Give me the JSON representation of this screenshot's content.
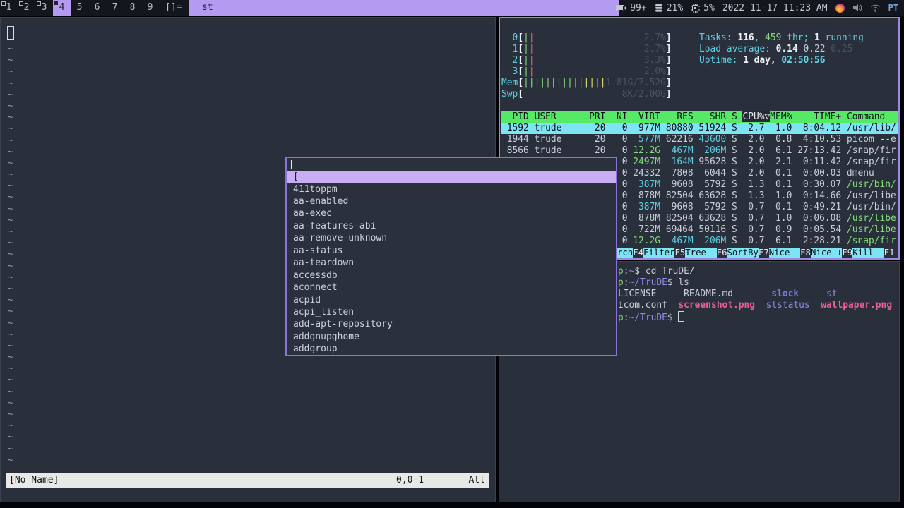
{
  "colors": {
    "accent_lavender": "#b49af0",
    "focused_border_purple": "#9c88e0",
    "dmenu_border": "#8a74da",
    "dmenu_selected_bg": "#c9aef5",
    "htop_header_green": "#56e965",
    "htop_selected_cyan": "#7ce4f2",
    "keyboard_layout_blue": "#6fa8dc"
  },
  "bar": {
    "tags": [
      {
        "label": "1",
        "state": "occupied"
      },
      {
        "label": "2",
        "state": "occupied"
      },
      {
        "label": "3",
        "state": "occupied"
      },
      {
        "label": "4",
        "state": "selected"
      },
      {
        "label": "5",
        "state": "empty"
      },
      {
        "label": "6",
        "state": "empty"
      },
      {
        "label": "7",
        "state": "empty"
      },
      {
        "label": "8",
        "state": "empty"
      },
      {
        "label": "9",
        "state": "empty"
      }
    ],
    "layout_symbol": "[]=",
    "title": "st",
    "status": {
      "battery": "99+",
      "disk": "21%",
      "mem": "5%",
      "datetime": "2022-11-17 11:23 AM",
      "keyboard": "PT",
      "icons": [
        "battery-icon",
        "disk-icon",
        "chip-icon",
        "flame-tray-icon",
        "volume-icon",
        "wifi-icon"
      ]
    }
  },
  "vim": {
    "tildes": [
      "~",
      "~",
      "~",
      "~",
      "~",
      "~",
      "~",
      "~",
      "~",
      "~",
      "~",
      "~",
      "~",
      "~",
      "~",
      "~",
      "~",
      "~",
      "~",
      "~",
      "~",
      "~",
      "~",
      "~",
      "~",
      "~",
      "~",
      "~",
      "~",
      "~",
      "~",
      "~",
      "~",
      "~",
      "~",
      "~",
      "~"
    ],
    "statusline": {
      "file": "[No Name]",
      "position": "0,0-1",
      "scroll": "All"
    }
  },
  "htop": {
    "meters": [
      [
        [
          "  0",
          "cy"
        ],
        [
          "[",
          "wb"
        ],
        [
          "|",
          "gr"
        ],
        [
          "|",
          "rd"
        ],
        [
          "                    ",
          ""
        ],
        [
          "2.7%",
          "dm"
        ],
        [
          "]",
          "wb"
        ]
      ],
      [
        [
          "  1",
          "cy"
        ],
        [
          "[",
          "wb"
        ],
        [
          "|",
          "gr"
        ],
        [
          "|",
          "rd"
        ],
        [
          "                    ",
          ""
        ],
        [
          "2.7%",
          "dm"
        ],
        [
          "]",
          "wb"
        ]
      ],
      [
        [
          "  2",
          "cy"
        ],
        [
          "[",
          "wb"
        ],
        [
          "|",
          "gr"
        ],
        [
          "|",
          "rd"
        ],
        [
          "                    ",
          ""
        ],
        [
          "3.3%",
          "dm"
        ],
        [
          "]",
          "wb"
        ]
      ],
      [
        [
          "  3",
          "cy"
        ],
        [
          "[",
          "wb"
        ],
        [
          "|",
          "gr"
        ],
        [
          "|",
          "rd"
        ],
        [
          "                    ",
          ""
        ],
        [
          "2.0%",
          "dm"
        ],
        [
          "]",
          "wb"
        ]
      ],
      [
        [
          "Mem",
          "cy"
        ],
        [
          "[",
          "wb"
        ],
        [
          "|||||||||",
          "gr"
        ],
        [
          "|",
          "pu"
        ],
        [
          "|||||",
          "yl"
        ],
        [
          "1.81G/7.52G",
          "dm"
        ],
        [
          "]",
          "wb"
        ]
      ],
      [
        [
          "Swp",
          "cy"
        ],
        [
          "[",
          "wb"
        ],
        [
          "                  ",
          ""
        ],
        [
          "8K/2.00G",
          "dm"
        ],
        [
          "]",
          "wb"
        ]
      ]
    ],
    "summary": [
      [
        [
          "Tasks: ",
          "cy"
        ],
        [
          "116",
          "wb"
        ],
        [
          ", ",
          "cy"
        ],
        [
          "459",
          "gr"
        ],
        [
          " thr; ",
          "cy"
        ],
        [
          "1",
          "wb"
        ],
        [
          " running",
          "cy"
        ]
      ],
      [
        [
          "Load average: ",
          "cy"
        ],
        [
          "0.14 ",
          "wb"
        ],
        [
          "0.22 ",
          ""
        ],
        [
          "0.25",
          "dm"
        ]
      ],
      [
        [
          "Uptime: ",
          "cy"
        ],
        [
          "1 day, ",
          "wb"
        ],
        [
          "02:50:56",
          "cyb"
        ]
      ]
    ],
    "table": [
      {
        "cls": "hdr",
        "nm": "table-header",
        "segs": [
          [
            "  PID USER      PRI  NI  VIRT   RES   SHR S ",
            "hg"
          ],
          [
            "CPU%▽",
            "hd"
          ],
          [
            "MEM%    TIME+ Command",
            "hg"
          ]
        ]
      },
      {
        "cls": "sel",
        "nm": "process-row-selected",
        "segs": [
          [
            " 1592 trude      20   0  977M 80880 51924 S  2.7  1.0  8:04.12 /usr/lib/",
            ""
          ]
        ]
      },
      [
        [
          " 1944 trude      20   0",
          ""
        ],
        [
          "  577M",
          "cy"
        ],
        [
          " 62216",
          ""
        ],
        [
          " 43600",
          "cy"
        ],
        [
          " S  2.0  0.8  4:10.53 picom --e",
          ""
        ]
      ],
      [
        [
          " 8566 trude      20   0",
          ""
        ],
        [
          " 12.2G",
          "gr"
        ],
        [
          "  467M",
          "cy"
        ],
        [
          "  206M",
          "cy"
        ],
        [
          " S  2.0  6.1 27:13.42 /snap/fir",
          ""
        ]
      ],
      [
        [
          "                      0",
          ""
        ],
        [
          " 2497M",
          "gr"
        ],
        [
          "  164M",
          "cy"
        ],
        [
          " 95628",
          ""
        ],
        [
          " S  2.0  2.1  0:11.42 /snap/fir",
          ""
        ]
      ],
      [
        [
          "                      0 24332  7808  6044 S  2.0  0.1  0:00.03 dmenu",
          ""
        ]
      ],
      [
        [
          "                      0",
          ""
        ],
        [
          "  387M",
          "cy"
        ],
        [
          "  9608  5792 S  1.3  0.1  0:30.07 ",
          ""
        ],
        [
          "/usr/bin/",
          "gr"
        ]
      ],
      [
        [
          "                      0  878M 82504 63628 S  1.3  1.0  0:14.66 /usr/libe",
          ""
        ]
      ],
      [
        [
          "                      0",
          ""
        ],
        [
          "  387M",
          "cy"
        ],
        [
          "  9608  5792 S  0.7  0.1  0:49.21 /usr/bin/",
          ""
        ]
      ],
      [
        [
          "                      0  878M 82504 63628 S  0.7  1.0  0:06.08 ",
          ""
        ],
        [
          "/usr/libe",
          "gr"
        ]
      ],
      [
        [
          "                      0  722M 69464 50116 S  0.7  0.9  0:05.54 ",
          ""
        ],
        [
          "/usr/libe",
          "gr"
        ]
      ],
      [
        [
          "                      0",
          ""
        ],
        [
          " 12.2G",
          "gr"
        ],
        [
          "  467M",
          "cy"
        ],
        [
          "  206M",
          "cy"
        ],
        [
          " S  0.7  6.1  2:28.21 ",
          ""
        ],
        [
          "/snap/fir",
          "gr"
        ]
      ]
    ],
    "fkeys": [
      [
        [
          "rch",
          "fk"
        ],
        [
          "F4",
          "fd"
        ],
        [
          "Filter",
          "fk"
        ],
        [
          "F5",
          "fd"
        ],
        [
          "Tree  ",
          "fk"
        ],
        [
          "F6",
          "fd"
        ],
        [
          "SortBy",
          "fk"
        ],
        [
          "F7",
          "fd"
        ],
        [
          "Nice -",
          "fk"
        ],
        [
          "F8",
          "fd"
        ],
        [
          "Nice +",
          "fk"
        ],
        [
          "F9",
          "fd"
        ],
        [
          "Kill  ",
          "fk"
        ],
        [
          "F1",
          "fd"
        ]
      ]
    ]
  },
  "terminal": {
    "lines": [
      [
        [
          "p",
          "pg"
        ],
        [
          ":",
          ""
        ],
        [
          "~",
          "pu"
        ],
        [
          "$ cd TruDE/",
          ""
        ]
      ],
      [
        [
          "p",
          "pg"
        ],
        [
          ":",
          ""
        ],
        [
          "~/TruDE",
          "pu"
        ],
        [
          "$ ls",
          ""
        ]
      ],
      [
        [
          "LICENSE     README.md       ",
          ""
        ],
        [
          "slock",
          "bl"
        ],
        [
          "     ",
          ""
        ],
        [
          "st",
          "pu"
        ]
      ],
      [
        [
          "icom.conf  ",
          ""
        ],
        [
          "screenshot.png",
          "mg"
        ],
        [
          "  ",
          ""
        ],
        [
          "slstatus",
          "pu"
        ],
        [
          "  ",
          ""
        ],
        [
          "wallpaper.png",
          "mg"
        ]
      ],
      [
        [
          "p",
          "pg"
        ],
        [
          ":",
          ""
        ],
        [
          "~/TruDE",
          "pu"
        ],
        [
          "$ ",
          ""
        ],
        [
          "",
          "cur"
        ]
      ]
    ]
  },
  "dmenu": {
    "query": "",
    "selected": "[",
    "items": [
      "411toppm",
      "aa-enabled",
      "aa-exec",
      "aa-features-abi",
      "aa-remove-unknown",
      "aa-status",
      "aa-teardown",
      "accessdb",
      "aconnect",
      "acpid",
      "acpi_listen",
      "add-apt-repository",
      "addgnupghome",
      "addgroup"
    ]
  }
}
